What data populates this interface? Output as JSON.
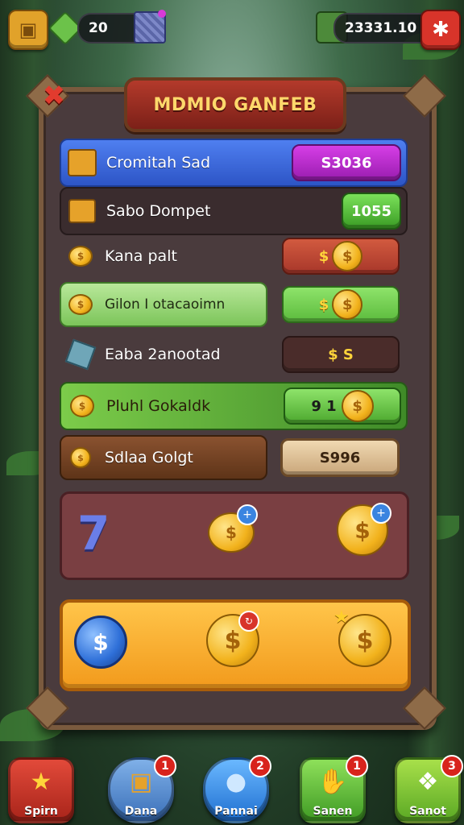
{
  "topbar": {
    "left_count": "20",
    "right_count": "23331.10"
  },
  "panel": {
    "title": "MDMIO GANFEB"
  },
  "rows": [
    {
      "label": "Cromitah Sad",
      "value": "S3036"
    },
    {
      "label": "Sabo Dompet",
      "value": "1055"
    },
    {
      "label": "Kana palt",
      "value": "$"
    },
    {
      "label": "Gilon I otacaoimn",
      "value": "$"
    },
    {
      "label": "Eaba 2anootad",
      "value": "$ S"
    },
    {
      "label": "Pluhl Gokaldk",
      "value": "9 1"
    },
    {
      "label": "Sdlaa Golgt",
      "value": "S996"
    }
  ],
  "bottom_nav": [
    {
      "label": "Spirn",
      "badge": "",
      "color": "#c22a22",
      "icon": "star-icon"
    },
    {
      "label": "Dana",
      "badge": "1",
      "color": "#4a7fc0",
      "icon": "box-icon"
    },
    {
      "label": "Pannai",
      "badge": "2",
      "color": "#2f7fd0",
      "icon": "creature-icon"
    },
    {
      "label": "Sanen",
      "badge": "1",
      "color": "#4ba82f",
      "icon": "hand-icon"
    },
    {
      "label": "Sanot",
      "badge": "3",
      "color": "#6cbf2f",
      "icon": "cat-icon"
    }
  ]
}
